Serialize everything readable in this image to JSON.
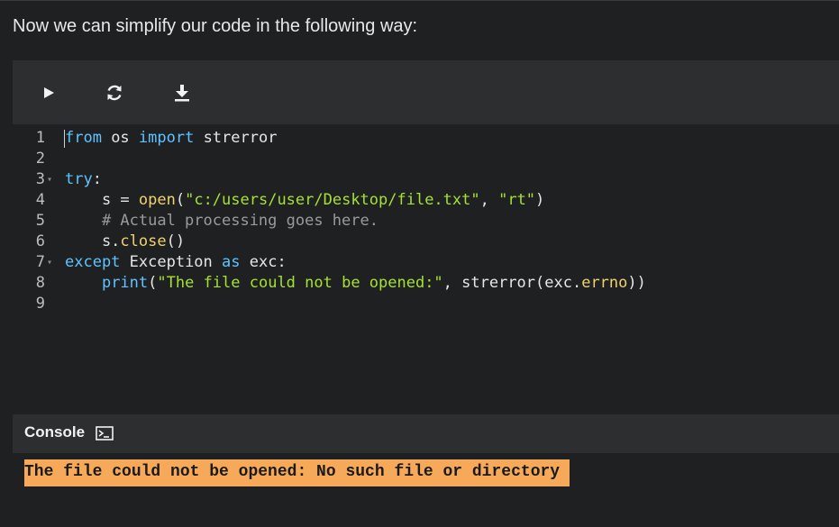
{
  "intro_text": "Now we can simplify our code in the following way:",
  "toolbar": {
    "buttons": [
      {
        "name": "run",
        "icon": "play-icon"
      },
      {
        "name": "reset",
        "icon": "refresh-icon"
      },
      {
        "name": "download",
        "icon": "download-icon"
      }
    ]
  },
  "code": {
    "line_numbers": [
      "1",
      "2",
      "3",
      "4",
      "5",
      "6",
      "7",
      "8",
      "9"
    ],
    "lines": [
      [
        {
          "t": "from",
          "c": "kw"
        },
        {
          "t": " os ",
          "c": ""
        },
        {
          "t": "import",
          "c": "kw"
        },
        {
          "t": " strerror",
          "c": ""
        }
      ],
      [],
      [
        {
          "t": "try",
          "c": "kw"
        },
        {
          "t": ":",
          "c": ""
        }
      ],
      [
        {
          "t": "    s = ",
          "c": ""
        },
        {
          "t": "open",
          "c": "fn"
        },
        {
          "t": "(",
          "c": ""
        },
        {
          "t": "\"c:/users/user/Desktop/file.txt\"",
          "c": "str"
        },
        {
          "t": ", ",
          "c": ""
        },
        {
          "t": "\"rt\"",
          "c": "str"
        },
        {
          "t": ")",
          "c": ""
        }
      ],
      [
        {
          "t": "    # Actual processing goes here.",
          "c": "cmt"
        }
      ],
      [
        {
          "t": "    s.",
          "c": ""
        },
        {
          "t": "close",
          "c": "fn"
        },
        {
          "t": "()",
          "c": ""
        }
      ],
      [
        {
          "t": "except",
          "c": "kw"
        },
        {
          "t": " Exception ",
          "c": ""
        },
        {
          "t": "as",
          "c": "kw"
        },
        {
          "t": " exc:",
          "c": ""
        }
      ],
      [
        {
          "t": "    ",
          "c": ""
        },
        {
          "t": "print",
          "c": "kw"
        },
        {
          "t": "(",
          "c": ""
        },
        {
          "t": "\"The file could not be opened:\"",
          "c": "str"
        },
        {
          "t": ", strerror(exc.",
          "c": ""
        },
        {
          "t": "errno",
          "c": "fn"
        },
        {
          "t": "))",
          "c": ""
        }
      ],
      []
    ],
    "fold_lines": [
      3,
      7
    ]
  },
  "console": {
    "label": "Console",
    "icon": "terminal-icon",
    "output": "The file could not be opened: No such file or directory"
  },
  "colors": {
    "background": "#1f2022",
    "toolbar": "#2d2e30",
    "keyword": "#5ec4ff",
    "string": "#a6e22e",
    "function": "#f0d36b",
    "comment": "#9a9a9a",
    "output_bg": "#f7a95a"
  }
}
